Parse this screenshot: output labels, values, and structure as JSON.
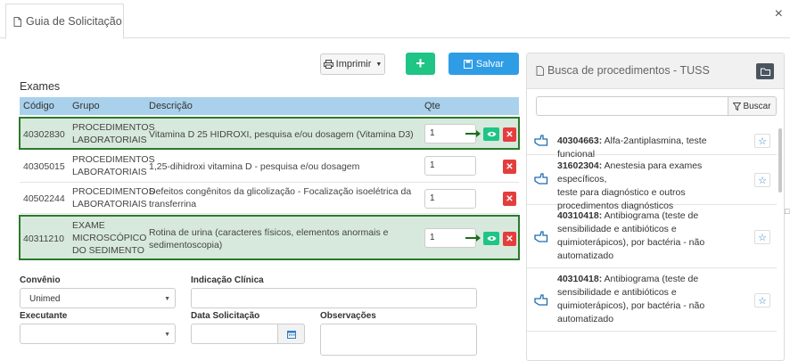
{
  "tab": {
    "title": "Guia de Solicitação",
    "icon": "document-icon"
  },
  "window": {
    "close_label": "×"
  },
  "toolbar": {
    "print_label": "Imprimir",
    "add_label": "+",
    "save_label": "Salvar"
  },
  "exams": {
    "title": "Exames",
    "columns": {
      "code": "Código",
      "group": "Grupo",
      "description": "Descrição",
      "qty": "Qte"
    },
    "rows": [
      {
        "code": "40302830",
        "group_l1": "PROCEDIMENTOS",
        "group_l2": "LABORATORIAIS",
        "group_l3": "",
        "desc_l1": "Vitamina D 25 HIDROXI, pesquisa e/ou dosagem (Vitamina D3)",
        "desc_l2": "",
        "qty": "1",
        "highlighted": true
      },
      {
        "code": "40305015",
        "group_l1": "PROCEDIMENTOS",
        "group_l2": "LABORATORIAIS",
        "group_l3": "",
        "desc_l1": "1,25-dihidroxi vitamina D - pesquisa e/ou dosagem",
        "desc_l2": "",
        "qty": "1",
        "highlighted": false
      },
      {
        "code": "40502244",
        "group_l1": "PROCEDIMENTOS",
        "group_l2": "LABORATORIAIS",
        "group_l3": "",
        "desc_l1": "Defeitos congênitos da glicolização - Focalização isoelétrica da",
        "desc_l2": "transferrina",
        "qty": "1",
        "highlighted": false
      },
      {
        "code": "40311210",
        "group_l1": "EXAME",
        "group_l2": "MICROSCÓPICO",
        "group_l3": "DO SEDIMENTO",
        "desc_l1": "Rotina de urina (caracteres físicos, elementos anormais e",
        "desc_l2": "sedimentoscopia)",
        "qty": "1",
        "highlighted": true
      }
    ]
  },
  "form": {
    "convenio_label": "Convênio",
    "convenio_value": "Unimed",
    "indicacao_label": "Indicação Clínica",
    "indicacao_value": "",
    "executante_label": "Executante",
    "executante_value": "",
    "data_label": "Data Solicitação",
    "data_value": "",
    "obs_label": "Observações",
    "obs_value": ""
  },
  "search_panel": {
    "title": "Busca de procedimentos - TUSS",
    "search_value": "",
    "search_button": "Buscar",
    "results": [
      {
        "code": "40304663:",
        "l1": " Alfa-2antiplasmina, teste funcional",
        "l2": "",
        "l3": "",
        "l4": ""
      },
      {
        "code": "31602304:",
        "l1": " Anestesia para exames específicos,",
        "l2": "teste para diagnóstico e outros",
        "l3": "procedimentos diagnósticos",
        "l4": ""
      },
      {
        "code": "40310418:",
        "l1": " Antibiograma (teste de",
        "l2": "sensibilidade e antibióticos e",
        "l3": "quimioterápicos), por bactéria - não",
        "l4": "automatizado"
      },
      {
        "code": "40310418:",
        "l1": " Antibiograma (teste de",
        "l2": "sensibilidade e antibióticos e",
        "l3": "quimioterápicos), por bactéria - não",
        "l4": "automatizado"
      }
    ]
  },
  "colors": {
    "green": "#1ec584",
    "blue": "#2f9de6",
    "red": "#e53d3d",
    "header_blue": "#a9d1ec",
    "highlight_border": "#2b7a2b"
  }
}
